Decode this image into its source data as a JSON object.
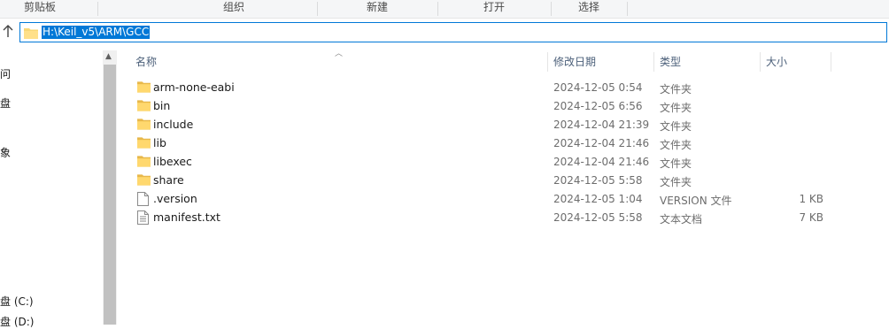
{
  "ribbon": {
    "groups": [
      "剪贴板",
      "组织",
      "新建",
      "打开",
      "选择"
    ]
  },
  "address": {
    "path": "H:\\Keil_v5\\ARM\\GCC",
    "up_icon": "up-arrow-icon"
  },
  "nav": {
    "items": [
      "问",
      "盘",
      "象",
      "盘 (C:)",
      "盘 (D:)"
    ]
  },
  "columns": {
    "name": "名称",
    "modified": "修改日期",
    "type": "类型",
    "size": "大小"
  },
  "files": [
    {
      "name": "arm-none-eabi",
      "modified": "2024-12-05 0:54",
      "type": "文件夹",
      "size": "",
      "icon": "folder-icon"
    },
    {
      "name": "bin",
      "modified": "2024-12-05 6:56",
      "type": "文件夹",
      "size": "",
      "icon": "folder-icon"
    },
    {
      "name": "include",
      "modified": "2024-12-04 21:39",
      "type": "文件夹",
      "size": "",
      "icon": "folder-icon"
    },
    {
      "name": "lib",
      "modified": "2024-12-04 21:46",
      "type": "文件夹",
      "size": "",
      "icon": "folder-icon"
    },
    {
      "name": "libexec",
      "modified": "2024-12-04 21:46",
      "type": "文件夹",
      "size": "",
      "icon": "folder-icon"
    },
    {
      "name": "share",
      "modified": "2024-12-05 5:58",
      "type": "文件夹",
      "size": "",
      "icon": "folder-icon"
    },
    {
      "name": ".version",
      "modified": "2024-12-05 1:04",
      "type": "VERSION 文件",
      "size": "1 KB",
      "icon": "file-icon"
    },
    {
      "name": "manifest.txt",
      "modified": "2024-12-05 5:58",
      "type": "文本文档",
      "size": "7 KB",
      "icon": "text-file-icon"
    }
  ]
}
